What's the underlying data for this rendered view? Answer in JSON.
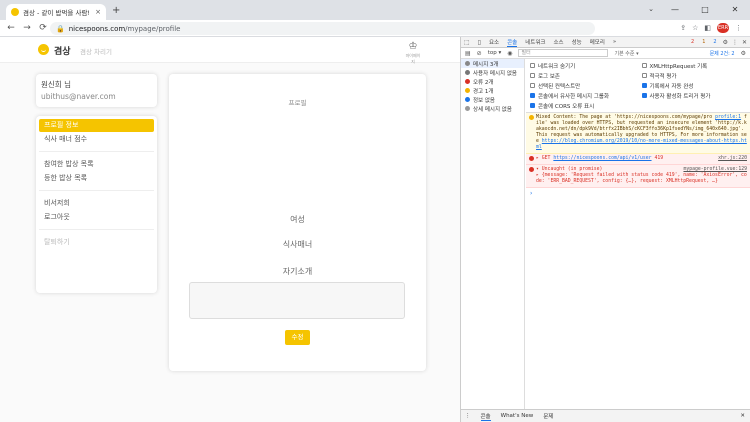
{
  "browser": {
    "tab_title": "겸상 - 같이 밥먹을 사람!",
    "tab_close": "×",
    "new_tab": "+",
    "tab_menu": "⌄",
    "win_min": "—",
    "win_max": "□",
    "win_close": "✕",
    "back": "←",
    "forward": "→",
    "reload": "⟳",
    "lock": "🔒",
    "url_host": "nicespoons.com",
    "url_path": "/mypage/profile",
    "profile_badge": "ERR",
    "icons": [
      "share-icon",
      "star-icon",
      "extension-icon",
      "menu-icon"
    ]
  },
  "site": {
    "brand": "겸상",
    "brand_sub": "겸상 차리기",
    "mypage_label": "마이페이지",
    "user": {
      "name": "원신희 님",
      "email": "ubithus@naver.com"
    },
    "menu": [
      {
        "label": "프로필 정보",
        "active": true
      },
      {
        "label": "식사 매너 점수",
        "active": false
      },
      {
        "label": "참여한 밥상 목록",
        "active": false
      },
      {
        "label": "등한 밥상 목록",
        "active": false
      },
      {
        "label": "비서저희",
        "active": false
      },
      {
        "label": "로그아웃",
        "active": false
      },
      {
        "label": "탈퇴하기",
        "active": false
      }
    ],
    "profile": {
      "heading": "프로필",
      "gender": "여성",
      "manner": "식사매너",
      "intro": "자기소개",
      "save": "수정"
    }
  },
  "devtools": {
    "tabs": [
      "요소",
      "콘솔",
      "네트워크",
      "소스",
      "성능",
      "메모리",
      "»"
    ],
    "active_tab": "콘솔",
    "error_count": "2",
    "warn_count": "1",
    "info_count": "2",
    "filter": {
      "context": "top ▾",
      "placeholder": "필터",
      "levels": "기본 수준 ▾",
      "issues": "문제 2건: 2"
    },
    "sidebar": [
      {
        "label": "메시지 3개",
        "icon": "list"
      },
      {
        "label": "사용자 메시지 없음",
        "icon": "user"
      },
      {
        "label": "오류 2개",
        "icon": "err"
      },
      {
        "label": "경고 1개",
        "icon": "warn"
      },
      {
        "label": "정보 없음",
        "icon": "info"
      },
      {
        "label": "상세 메시지 없음",
        "icon": "verb"
      }
    ],
    "options": [
      {
        "label": "네트워크 숨기기",
        "checked": false
      },
      {
        "label": "XMLHttpRequest 기록",
        "checked": false
      },
      {
        "label": "로그 보존",
        "checked": false
      },
      {
        "label": "적극적 평가",
        "checked": false
      },
      {
        "label": "선택된 컨텍스트만",
        "checked": false
      },
      {
        "label": "기록에서 자동 완성",
        "checked": true
      },
      {
        "label": "콘솔에서 유사한 메시지 그룹화",
        "checked": true
      },
      {
        "label": "사용자 활성화 트리거 평가",
        "checked": true
      },
      {
        "label": "콘솔에 CORS 오류 표시",
        "checked": true
      }
    ],
    "messages": {
      "warn_text_1": "Mixed Content: The page at 'https://nicespoons.com/mypage/pro",
      "warn_link_1": "profile:1",
      "warn_text_2": "file' was loaded over HTTPS, but requested an insecure element 'http://k.kakaocdn.net/dn/dpk9Vd/btrfx2IBbhS/cKCF3ffo36Kp1fsedYNs/img_640x640.jpg'. This request was automatically upgraded to HTTPS, For more information see",
      "warn_link_2": "https://blog.chromium.org/2019/10/no-more-mixed-messages-about-https.html",
      "err1_text": "▸ GET",
      "err1_link": "https://nicespoons.com/api/v1/user",
      "err1_code": "419",
      "err1_src": "xhr.js:220",
      "err2_text": "▾ Uncaught (in promise)",
      "err2_src": "mypage-profile.vue:129",
      "err2_detail": "▸ {message: 'Request failed with status code 419', name: 'AxiosError', code: 'ERR_BAD_REQUEST', config: {…}, request: XMLHttpRequest, …}",
      "prompt": "›"
    },
    "drawer": [
      "콘솔",
      "What's New",
      "문제"
    ],
    "drawer_close": "✕"
  }
}
